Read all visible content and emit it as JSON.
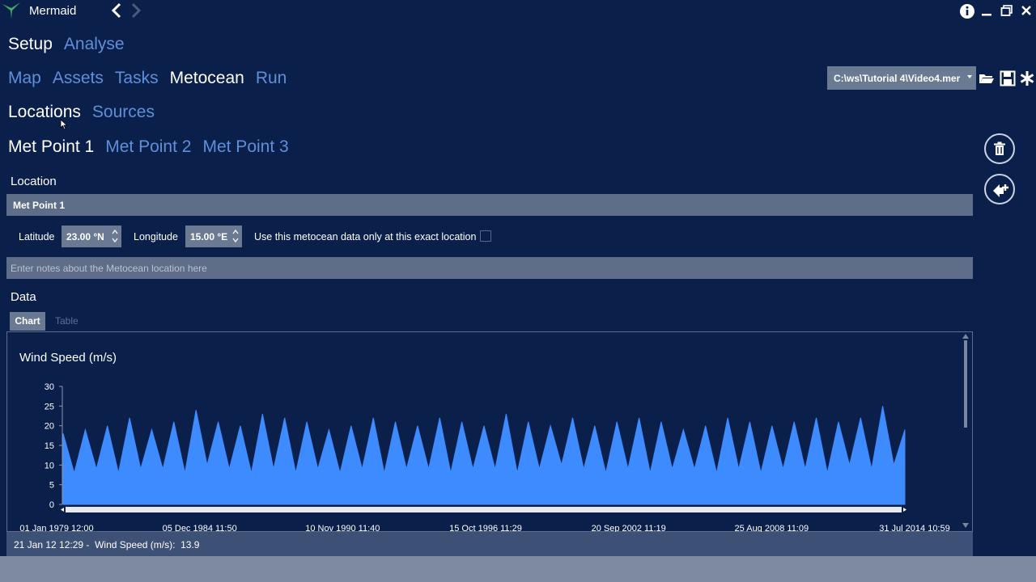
{
  "app": {
    "title": "Mermaid"
  },
  "nav": {
    "level1": [
      {
        "label": "Setup",
        "active": true
      },
      {
        "label": "Analyse",
        "active": false
      }
    ],
    "level2": [
      {
        "label": "Map",
        "active": false
      },
      {
        "label": "Assets",
        "active": false
      },
      {
        "label": "Tasks",
        "active": false
      },
      {
        "label": "Metocean",
        "active": true
      },
      {
        "label": "Run",
        "active": false
      }
    ],
    "level3": [
      {
        "label": "Locations",
        "active": true
      },
      {
        "label": "Sources",
        "active": false
      }
    ],
    "level4": [
      {
        "label": "Met Point 1",
        "active": true
      },
      {
        "label": "Met Point 2",
        "active": false
      },
      {
        "label": "Met Point 3",
        "active": false
      }
    ]
  },
  "toolbar": {
    "file_path": "C:\\ws\\Tutorial 4\\Video4.mer"
  },
  "location": {
    "heading": "Location",
    "name_value": "Met Point 1",
    "latitude_label": "Latitude",
    "latitude_value": "23.00 °N",
    "longitude_label": "Longitude",
    "longitude_value": "15.00 °E",
    "exact_label": "Use this metocean data only at this exact location",
    "exact_checked": false,
    "notes_placeholder": "Enter notes about the Metocean location here"
  },
  "data": {
    "heading": "Data",
    "tabs": [
      {
        "label": "Chart",
        "active": true
      },
      {
        "label": "Table",
        "active": false
      }
    ]
  },
  "chart_data": {
    "type": "area",
    "title": "Wind Speed (m/s)",
    "xlabel": "",
    "ylabel": "",
    "ylim": [
      0,
      30
    ],
    "yticks": [
      0,
      5,
      10,
      15,
      20,
      25,
      30
    ],
    "xtick_labels": [
      "01 Jan 1979 12:00",
      "05 Dec 1984 11:50",
      "10 Nov 1990 11:40",
      "15 Oct 1996 11:29",
      "20 Sep 2002 11:19",
      "25 Aug 2008 11:09",
      "31 Jul 2014 10:59"
    ],
    "series": [
      {
        "color": "#3d8bff",
        "x": [
          "1979-01",
          "1979-07",
          "1980-01",
          "1980-07",
          "1981-01",
          "1981-07",
          "1982-01",
          "1982-07",
          "1983-01",
          "1983-07",
          "1984-01",
          "1984-07",
          "1985-01",
          "1985-07",
          "1986-01",
          "1986-07",
          "1987-01",
          "1987-07",
          "1988-01",
          "1988-07",
          "1989-01",
          "1989-07",
          "1990-01",
          "1990-07",
          "1991-01",
          "1991-07",
          "1992-01",
          "1992-07",
          "1993-01",
          "1993-07",
          "1994-01",
          "1994-07",
          "1995-01",
          "1995-07",
          "1996-01",
          "1996-07",
          "1997-01",
          "1997-07",
          "1998-01",
          "1998-07",
          "1999-01",
          "1999-07",
          "2000-01",
          "2000-07",
          "2001-01",
          "2001-07",
          "2002-01",
          "2002-07",
          "2003-01",
          "2003-07",
          "2004-01",
          "2004-07",
          "2005-01",
          "2005-07",
          "2006-01",
          "2006-07",
          "2007-01",
          "2007-07",
          "2008-01",
          "2008-07",
          "2009-01",
          "2009-07",
          "2010-01",
          "2010-07",
          "2011-01",
          "2011-07",
          "2012-01",
          "2012-07",
          "2013-01",
          "2013-07",
          "2014-01",
          "2014-07",
          "2015-01",
          "2015-07",
          "2016-01",
          "2016-07",
          "2017-01"
        ],
        "values": [
          18,
          8,
          19,
          9,
          20,
          8,
          22,
          9,
          19,
          9,
          21,
          8,
          24,
          10,
          21,
          9,
          20,
          8,
          23,
          9,
          22,
          8,
          21,
          9,
          19,
          8,
          20,
          9,
          22,
          8,
          21,
          9,
          20,
          9,
          22,
          8,
          21,
          9,
          20,
          9,
          23,
          8,
          21,
          9,
          20,
          10,
          22,
          9,
          20,
          8,
          21,
          9,
          22,
          8,
          21,
          9,
          19,
          9,
          20,
          8,
          22,
          9,
          21,
          8,
          20,
          9,
          21,
          9,
          22,
          8,
          21,
          10,
          22,
          9,
          25,
          10,
          19
        ]
      }
    ]
  },
  "status": {
    "timestamp": "21 Jan 12 12:29",
    "separator": " -  ",
    "readout": "Wind Speed (m/s):  13.9"
  }
}
